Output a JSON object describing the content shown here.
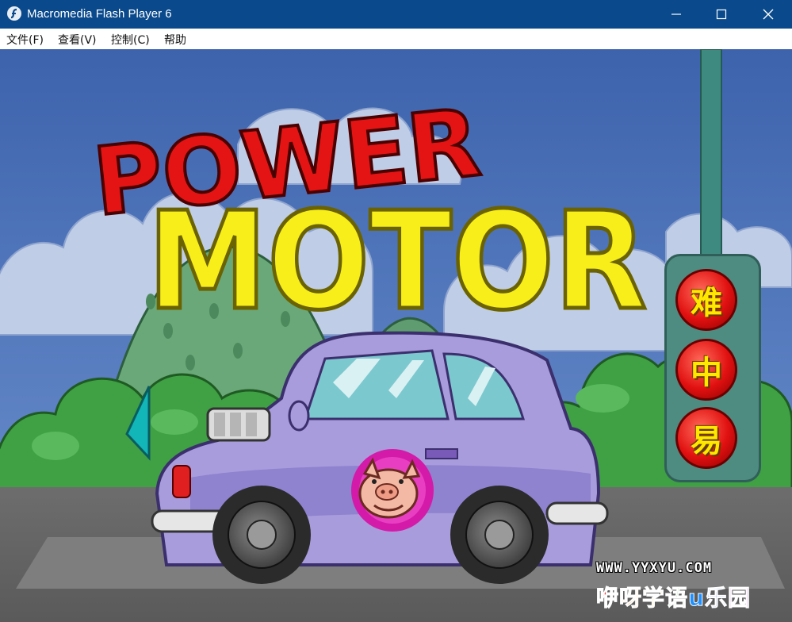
{
  "window": {
    "title": "Macromedia Flash Player 6",
    "icon": "flash-player-icon",
    "controls": [
      "minimize-icon",
      "maximize-icon",
      "close-icon"
    ]
  },
  "menu": {
    "file": "文件(F)",
    "view": "查看(V)",
    "control": "控制(C)",
    "help": "帮助"
  },
  "game": {
    "logo_line1": "POWER",
    "logo_line2": "MOTOR",
    "difficulty": {
      "hard": "难",
      "medium": "中",
      "easy": "易"
    },
    "prev_arrow_icon": "left-arrow-icon",
    "car_emblem_icon": "pig-face-icon",
    "site_url": "WWW.YYXYU.COM",
    "site_name": [
      "咿",
      "呀",
      "学",
      "语",
      "u",
      "乐",
      "园"
    ],
    "colors": {
      "titlebar": "#0a4a8c",
      "logo_red": "#e41414",
      "logo_yellow": "#f7ee1a",
      "car_purple": "#a99cdc",
      "panel_teal": "#4e8b80",
      "arrow_teal": "#12b5b8"
    }
  }
}
